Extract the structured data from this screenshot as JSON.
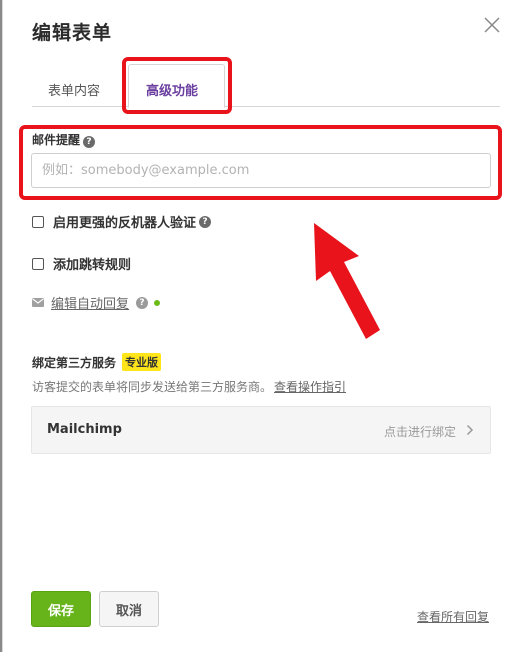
{
  "dialog": {
    "title": "编辑表单"
  },
  "tabs": [
    {
      "label": "表单内容"
    },
    {
      "label": "高级功能"
    }
  ],
  "email_reminder": {
    "label": "邮件提醒",
    "placeholder": "例如：somebody@example.com",
    "value": ""
  },
  "options": {
    "captcha_label": "启用更强的反机器人验证",
    "jump_rule_label": "添加跳转规则"
  },
  "auto_reply": {
    "link_label": "编辑自动回复"
  },
  "third_party": {
    "title": "绑定第三方服务",
    "badge": "专业版",
    "description": "访客提交的表单将同步发送给第三方服务商。",
    "guide_link": "查看操作指引",
    "service_name": "Mailchimp",
    "service_action": "点击进行绑定"
  },
  "footer": {
    "save_label": "保存",
    "cancel_label": "取消",
    "view_all_label": "查看所有回复"
  },
  "colors": {
    "accent_purple": "#6b3fa0",
    "save_green": "#66b41a",
    "annotation_red": "#e8131b",
    "badge_yellow": "#ffe51a",
    "status_green": "#6dbb1a"
  }
}
